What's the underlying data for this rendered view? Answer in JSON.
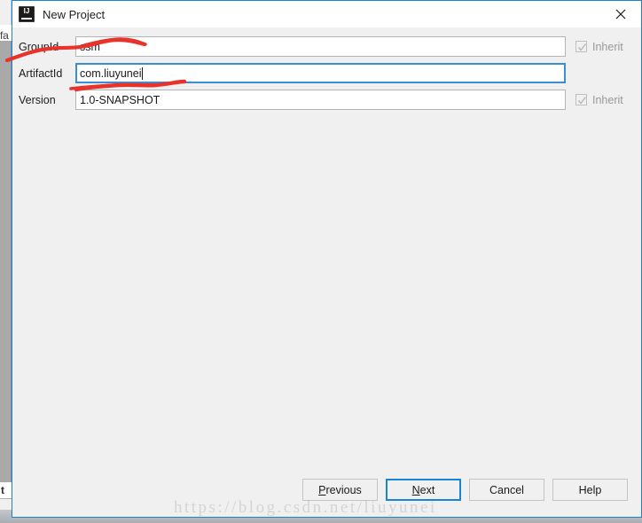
{
  "background_window": {
    "tab_label": "fa",
    "status_label": "t"
  },
  "dialog": {
    "title": "New Project",
    "app_icon": "intellij-idea-icon",
    "close_icon": "close-icon",
    "accent_color": "#1883d7",
    "background_color": "#f0f0f0",
    "fields": [
      {
        "label": "GroupId",
        "value": "ssm",
        "focused": false,
        "inherit": {
          "label": "Inherit",
          "checked": true,
          "enabled": false
        }
      },
      {
        "label": "ArtifactId",
        "value": "com.liuyunei",
        "focused": true,
        "inherit": null
      },
      {
        "label": "Version",
        "value": "1.0-SNAPSHOT",
        "focused": false,
        "inherit": {
          "label": "Inherit",
          "checked": true,
          "enabled": false
        }
      }
    ],
    "buttons": [
      {
        "label": "Previous",
        "mnemonic": "P",
        "default": false
      },
      {
        "label": "Next",
        "mnemonic": "N",
        "default": true
      },
      {
        "label": "Cancel",
        "mnemonic": "",
        "default": false
      },
      {
        "label": "Help",
        "mnemonic": "",
        "default": false
      }
    ]
  },
  "annotations": {
    "color": "#e8322a",
    "description": "hand-drawn red underline strokes under GroupId label/value and under Version row"
  },
  "watermark": {
    "text": "https://blog.csdn.net/liuyunei"
  }
}
